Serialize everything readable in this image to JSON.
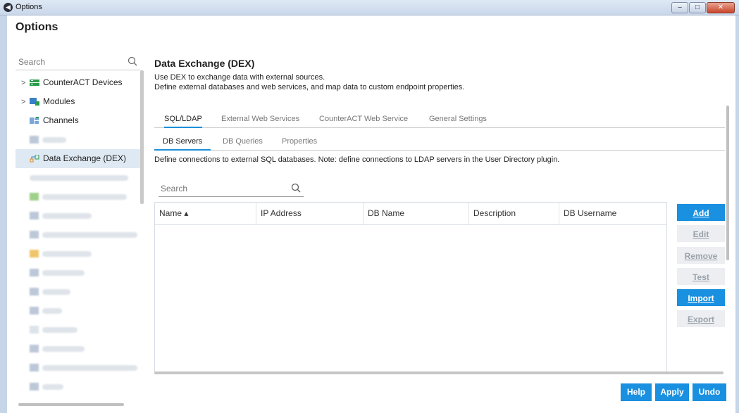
{
  "window": {
    "title": "Options",
    "heading": "Options"
  },
  "sidebar": {
    "search_placeholder": "Search",
    "items": [
      {
        "label": "CounterACT Devices",
        "expandable": true,
        "icon": "devices-icon"
      },
      {
        "label": "Modules",
        "expandable": true,
        "icon": "modules-icon"
      },
      {
        "label": "Channels",
        "expandable": false,
        "icon": "channels-icon"
      },
      {
        "label": "Data Exchange (DEX)",
        "expandable": false,
        "icon": "dex-icon",
        "selected": true
      }
    ]
  },
  "main": {
    "title": "Data Exchange (DEX)",
    "desc_line1": "Use DEX to exchange data with external sources.",
    "desc_line2": "Define external databases and web services, and map data to custom endpoint properties.",
    "tabs": [
      "SQL/LDAP",
      "External Web Services",
      "CounterACT Web Service",
      "General Settings"
    ],
    "subtabs": [
      "DB Servers",
      "DB Queries",
      "Properties"
    ],
    "subdesc": "Define connections to external SQL databases. Note: define connections to LDAP servers in the User Directory plugin.",
    "grid_search_placeholder": "Search",
    "columns": [
      "Name ▴",
      "IP Address",
      "DB Name",
      "Description",
      "DB Username"
    ],
    "rows": []
  },
  "side_buttons": [
    {
      "label": "Add",
      "enabled": true
    },
    {
      "label": "Edit",
      "enabled": false
    },
    {
      "label": "Remove",
      "enabled": false
    },
    {
      "label": "Test",
      "enabled": false
    },
    {
      "label": "Import",
      "enabled": true
    },
    {
      "label": "Export",
      "enabled": false
    }
  ],
  "footer": {
    "help": "Help",
    "apply": "Apply",
    "undo": "Undo"
  },
  "colors": {
    "accent": "#1a90e0",
    "selected_row": "#dfe9f3",
    "disabled_button": "#eceef1"
  }
}
